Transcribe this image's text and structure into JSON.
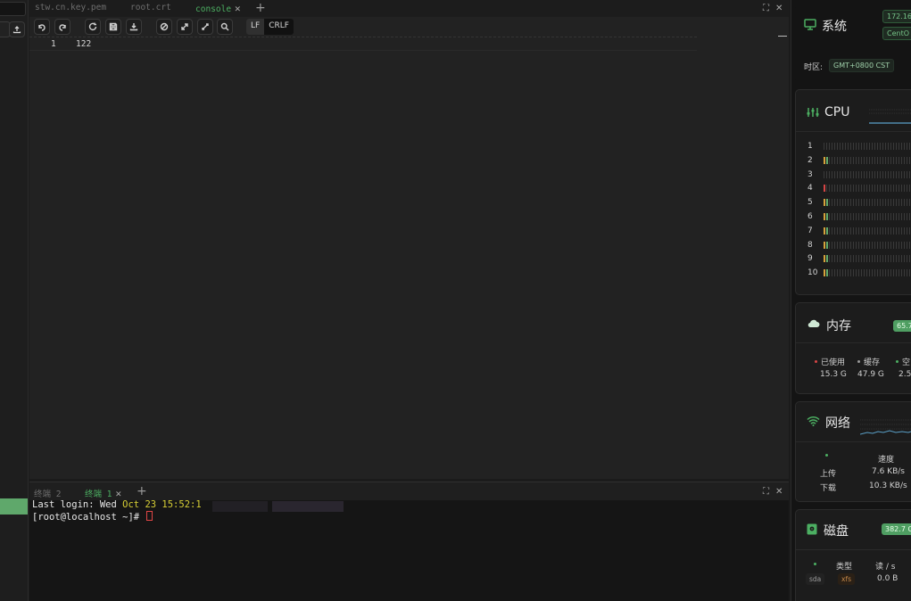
{
  "editor": {
    "tabs": [
      {
        "label": "stw.cn.key.pem",
        "active": false
      },
      {
        "label": "root.crt",
        "active": false
      },
      {
        "label": "console",
        "active": true
      }
    ],
    "eol_options": [
      "LF",
      "CRLF"
    ],
    "eol_selected": "LF",
    "lines": [
      {
        "num": "1",
        "text": "122"
      }
    ]
  },
  "terminal": {
    "tabs": [
      {
        "label": "终端 2",
        "active": false
      },
      {
        "label": "终端 1",
        "active": true
      }
    ],
    "line1_prefix": "Last login: Wed ",
    "line1_date": "Oct 23 15:52:1",
    "prompt": "[root@localhost ~]# "
  },
  "system": {
    "title": "系统",
    "ip": "172.16",
    "os": "CentO",
    "timezone_label": "时区:",
    "timezone": "GMT+0800  CST"
  },
  "cpu": {
    "title": "CPU",
    "cores": [
      {
        "id": "1",
        "load": 0
      },
      {
        "id": "2",
        "load": 2
      },
      {
        "id": "3",
        "load": 0
      },
      {
        "id": "4",
        "load": 1
      },
      {
        "id": "5",
        "load": 2
      },
      {
        "id": "6",
        "load": 2
      },
      {
        "id": "7",
        "load": 2
      },
      {
        "id": "8",
        "load": 2
      },
      {
        "id": "9",
        "load": 2
      },
      {
        "id": "10",
        "load": 2
      }
    ]
  },
  "memory": {
    "title": "内存",
    "percent": "65.7",
    "used_label": "已使用",
    "used": "15.3 G",
    "cache_label": "缓存",
    "cache": "47.9 G",
    "free_label": "空",
    "free": "2.5",
    "colors": {
      "used": "#d64545",
      "cache": "#9a9a9a",
      "free": "#4caf62"
    }
  },
  "network": {
    "title": "网络",
    "speed_header": "速度",
    "upload_label": "上传",
    "upload": "7.6 KB/s",
    "download_label": "下载",
    "download": "10.3 KB/s"
  },
  "disk": {
    "title": "磁盘",
    "total": "382.7 G",
    "type_header": "类型",
    "read_header": "读 / s",
    "device": "sda",
    "fs": "xfs",
    "read": "0.0 B"
  },
  "colors": {
    "accent": "#4caf62",
    "background": "#1b1b1b",
    "panel": "#1c1c1c"
  }
}
